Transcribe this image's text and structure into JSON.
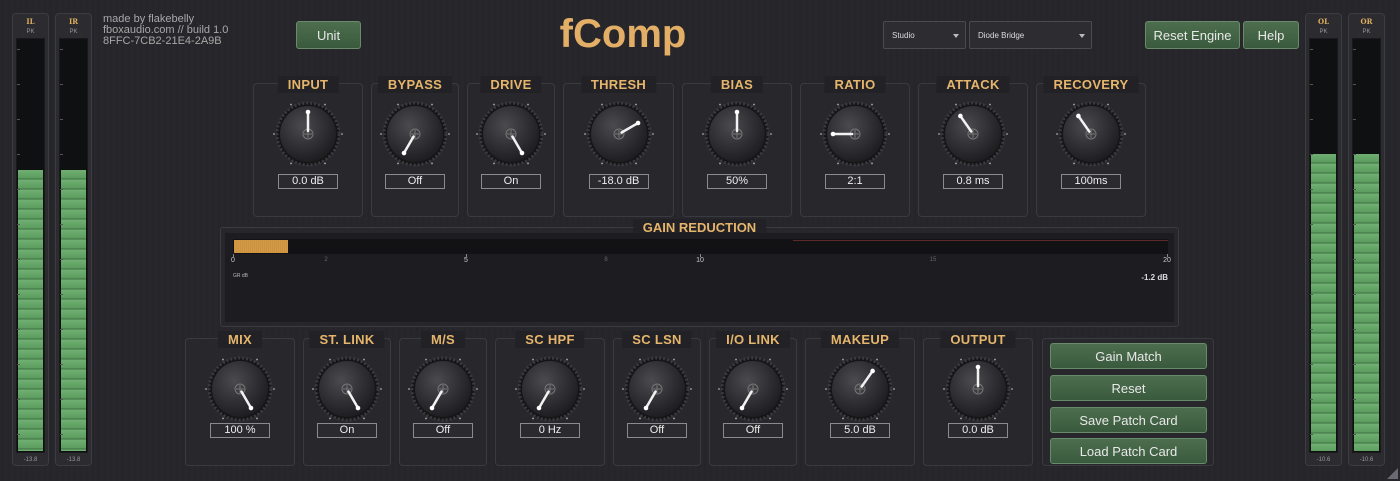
{
  "meta": {
    "author": "made by flakebelly",
    "site_build": "fboxaudio.com // build 1.0",
    "serial": "8FFC-7CB2-21E4-2A9B"
  },
  "title": "fComp",
  "unit_button": "Unit",
  "selects": {
    "preset": "Studio",
    "model": "Diode Bridge"
  },
  "header_buttons": {
    "reset_engine": "Reset Engine",
    "help": "Help"
  },
  "meters": [
    {
      "label": "IL",
      "pk": "PK",
      "value": "-13.8",
      "level": 0.68
    },
    {
      "label": "IR",
      "pk": "PK",
      "value": "-13.8",
      "level": 0.68
    },
    {
      "label": "OL",
      "pk": "PK",
      "value": "-10.6",
      "level": 0.72
    },
    {
      "label": "OR",
      "pk": "PK",
      "value": "-10.6",
      "level": 0.72
    }
  ],
  "top_knobs": [
    {
      "label": "INPUT",
      "value": "0.0 dB",
      "angle": 0
    },
    {
      "label": "BYPASS",
      "value": "Off",
      "angle": -150
    },
    {
      "label": "DRIVE",
      "value": "On",
      "angle": 150
    },
    {
      "label": "THRESH",
      "value": "-18.0 dB",
      "angle": 60
    },
    {
      "label": "BIAS",
      "value": "50%",
      "angle": 0
    },
    {
      "label": "RATIO",
      "value": "2:1",
      "angle": -90
    },
    {
      "label": "ATTACK",
      "value": "0.8 ms",
      "angle": -35
    },
    {
      "label": "RECOVERY",
      "value": "100ms",
      "angle": -35
    }
  ],
  "gain_reduction": {
    "label": "GAIN REDUCTION",
    "unit": "GR dB",
    "readout": "-1.2 dB",
    "level": 0.058,
    "major_ticks": [
      "0",
      "5",
      "10",
      "20"
    ],
    "minor_ticks": [
      "2",
      "8",
      "15"
    ]
  },
  "bottom_knobs": [
    {
      "label": "MIX",
      "value": "100 %",
      "angle": 150
    },
    {
      "label": "ST. LINK",
      "value": "On",
      "angle": 150
    },
    {
      "label": "M/S",
      "value": "Off",
      "angle": -150
    },
    {
      "label": "SC HPF",
      "value": "0 Hz",
      "angle": -150
    },
    {
      "label": "SC LSN",
      "value": "Off",
      "angle": -150
    },
    {
      "label": "I/O LINK",
      "value": "Off",
      "angle": -150
    },
    {
      "label": "MAKEUP",
      "value": "5.0 dB",
      "angle": 35
    },
    {
      "label": "OUTPUT",
      "value": "0.0 dB",
      "angle": 0
    }
  ],
  "patch_buttons": {
    "gain_match": "Gain Match",
    "reset": "Reset",
    "save": "Save Patch Card",
    "load": "Load Patch Card"
  },
  "colors": {
    "accent": "#e6b56c",
    "button": "#4c6e4e",
    "meter": "#6fb072",
    "gr": "#d9a04a"
  }
}
